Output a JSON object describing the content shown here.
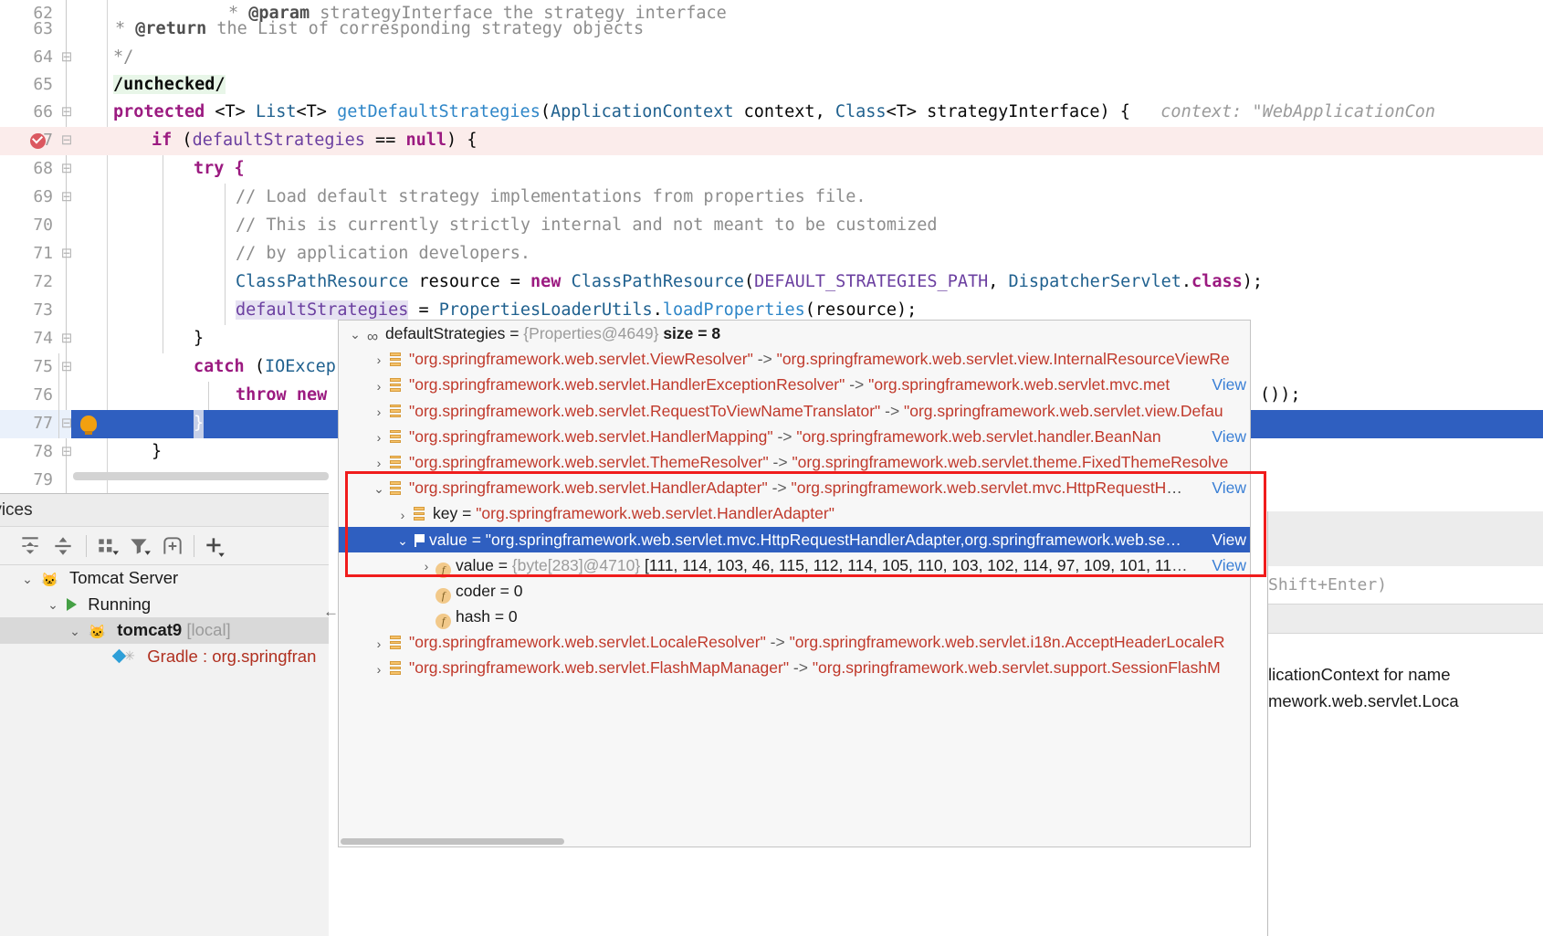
{
  "editor": {
    "lines": [
      {
        "num": "62",
        "fold": "",
        "kind": "jdoc"
      },
      {
        "num": "63",
        "fold": "",
        "kind": "jdoc2"
      },
      {
        "num": "64",
        "fold": "minus",
        "kind": "jdocend"
      },
      {
        "num": "65",
        "fold": "",
        "kind": "unchecked"
      },
      {
        "num": "66",
        "fold": "minus",
        "kind": "signature"
      },
      {
        "num": "67",
        "fold": "minus",
        "kind": "ifnull"
      },
      {
        "num": "68",
        "fold": "minus",
        "kind": "try"
      },
      {
        "num": "69",
        "fold": "minus",
        "kind": "c1"
      },
      {
        "num": "70",
        "fold": "",
        "kind": "c2"
      },
      {
        "num": "71",
        "fold": "minus",
        "kind": "c3"
      },
      {
        "num": "72",
        "fold": "",
        "kind": "cpr"
      },
      {
        "num": "73",
        "fold": "",
        "kind": "assign"
      },
      {
        "num": "74",
        "fold": "minus",
        "kind": "closeb"
      },
      {
        "num": "75",
        "fold": "minus",
        "kind": "catch"
      },
      {
        "num": "76",
        "fold": "",
        "kind": "throw"
      },
      {
        "num": "77",
        "fold": "minus",
        "kind": "sel"
      },
      {
        "num": "78",
        "fold": "minus",
        "kind": "closeb2"
      },
      {
        "num": "79",
        "fold": "",
        "kind": "blank"
      }
    ],
    "text": {
      "l62_star": "* ",
      "l62_tag": "@param",
      "l62_rest": " strategyInterface the strategy interface",
      "l63_star": "* ",
      "l63_tag": "@return",
      "l63_rest": " the List of corresponding strategy objects",
      "l64": "*/",
      "l65": "/unchecked/",
      "l66_kw": "protected",
      "l66_t1": " <T> ",
      "l66_t2": "List",
      "l66_t3": "<T> ",
      "l66_fn": "getDefaultStrategies",
      "l66_p1": "(",
      "l66_p2": "ApplicationContext",
      "l66_p3": " context, ",
      "l66_p4": "Class",
      "l66_p5": "<T> strategyInterface) {",
      "l66_hint": "context: \"WebApplicationCon",
      "l67_kw": "if",
      "l67_a": " (",
      "l67_var": "defaultStrategies",
      "l67_b": " == ",
      "l67_null": "null",
      "l67_c": ") {",
      "l68": "try {",
      "l69": "// Load default strategy implementations from properties file.",
      "l70": "// This is currently strictly internal and not meant to be customized",
      "l71": "// by application developers.",
      "l72_t": "ClassPathResource",
      "l72_a": " resource = ",
      "l72_new": "new",
      "l72_b": " ",
      "l72_t2": "ClassPathResource",
      "l72_c": "(",
      "l72_const": "DEFAULT_STRATEGIES_PATH",
      "l72_d": ", ",
      "l72_t3": "DispatcherServlet",
      "l72_e": ".",
      "l72_kw": "class",
      "l72_f": ");",
      "l73_var": "defaultStrategies",
      "l73_a": " = ",
      "l73_t": "PropertiesLoaderUtils",
      "l73_b": ".",
      "l73_fn": "loadProperties",
      "l73_c": "(resource);",
      "l74": "}",
      "l75_kw": "catch",
      "l75_a": " (",
      "l75_t": "IOExcep",
      "l76_kw": "throw new",
      "l76_tail": "());",
      "l77": "}",
      "l78": "}"
    }
  },
  "debugger": {
    "rows": [
      {
        "id": "root",
        "indent": 0,
        "twisty": "down",
        "icon": "oo",
        "name": "defaultStrategies",
        "eq": " = ",
        "type": "{Properties@4649}",
        "size": "size = 8",
        "view": "",
        "selected": false
      },
      {
        "id": "viewresolver",
        "indent": 1,
        "twisty": "right",
        "icon": "map",
        "key": "\"org.springframework.web.servlet.ViewResolver\"",
        "arrow": " -> ",
        "val": "\"org.springframework.web.servlet.view.InternalResourceViewRe",
        "view": "",
        "selected": false
      },
      {
        "id": "handlerexceptionresolver",
        "indent": 1,
        "twisty": "right",
        "icon": "map",
        "key": "\"org.springframework.web.servlet.HandlerExceptionResolver\"",
        "arrow": " -> ",
        "val": "\"org.springframework.web.servlet.mvc.met",
        "view": "View",
        "selected": false
      },
      {
        "id": "requesttoviewnametranslator",
        "indent": 1,
        "twisty": "right",
        "icon": "map",
        "key": "\"org.springframework.web.servlet.RequestToViewNameTranslator\"",
        "arrow": " -> ",
        "val": "\"org.springframework.web.servlet.view.Defau",
        "view": "",
        "selected": false
      },
      {
        "id": "handlermapping",
        "indent": 1,
        "twisty": "right",
        "icon": "map",
        "key": "\"org.springframework.web.servlet.HandlerMapping\"",
        "arrow": " -> ",
        "val": "\"org.springframework.web.servlet.handler.BeanNan",
        "view": "View",
        "selected": false
      },
      {
        "id": "themeresolver",
        "indent": 1,
        "twisty": "right",
        "icon": "map",
        "key": "\"org.springframework.web.servlet.ThemeResolver\"",
        "arrow": " -> ",
        "val": "\"org.springframework.web.servlet.theme.FixedThemeResolve",
        "view": "",
        "selected": false
      },
      {
        "id": "handleradapter",
        "indent": 1,
        "twisty": "down",
        "icon": "map",
        "key": "\"org.springframework.web.servlet.HandlerAdapter\"",
        "arrow": " -> ",
        "val": "\"org.springframework.web.servlet.mvc.HttpRequestH",
        "ellipsis": "…",
        "view": "View",
        "selected": false
      },
      {
        "id": "key",
        "indent": 2,
        "twisty": "right",
        "icon": "map",
        "name": "key",
        "eq": " = ",
        "val": "\"org.springframework.web.servlet.HandlerAdapter\"",
        "view": "",
        "selected": false
      },
      {
        "id": "value",
        "indent": 2,
        "twisty": "down",
        "icon": "flag",
        "name": "value",
        "eq": " = ",
        "val": "\"org.springframework.web.servlet.mvc.HttpRequestHandlerAdapter,org.springframework.web.se",
        "ellipsis": "…",
        "view": "View",
        "selected": true
      },
      {
        "id": "value-bytes",
        "indent": 3,
        "twisty": "right",
        "icon": "f",
        "name": "value",
        "eq": " = ",
        "type": "{byte[283]@4710}",
        "val": " [111, 114, 103, 46, 115, 112, 114, 105, 110, 103, 102, 114, 97, 109, 101, 11",
        "ellipsis": "…",
        "view": "View",
        "selected": false
      },
      {
        "id": "coder",
        "indent": 3,
        "twisty": "none",
        "icon": "f",
        "name": "coder",
        "eq": " = ",
        "val": "0",
        "view": "",
        "selected": false
      },
      {
        "id": "hash",
        "indent": 3,
        "twisty": "none",
        "icon": "f",
        "name": "hash",
        "eq": " = ",
        "val": "0",
        "view": "",
        "selected": false
      },
      {
        "id": "localeresolver",
        "indent": 1,
        "twisty": "right",
        "icon": "map",
        "key": "\"org.springframework.web.servlet.LocaleResolver\"",
        "arrow": " -> ",
        "val": "\"org.springframework.web.servlet.i18n.AcceptHeaderLocaleR",
        "view": "",
        "selected": false
      },
      {
        "id": "flashmapmanager",
        "indent": 1,
        "twisty": "right",
        "icon": "map",
        "key": "\"org.springframework.web.servlet.FlashMapManager\"",
        "arrow": " -> ",
        "val": "\"org.springframework.web.servlet.support.SessionFlashM",
        "view": "",
        "selected": false
      }
    ]
  },
  "services": {
    "tab_title": "rvices",
    "toolbar": [
      {
        "name": "expand-all-icon"
      },
      {
        "name": "collapse-all-icon"
      },
      {
        "name": "group-by-icon"
      },
      {
        "name": "filter-icon"
      },
      {
        "name": "add-tab-icon"
      },
      {
        "name": "add-icon"
      }
    ],
    "tree": [
      {
        "id": "tomcat-server",
        "indent": 0,
        "twisty": "down",
        "icon": "cat",
        "label": "Tomcat Server",
        "suffix": "",
        "bold": false,
        "selected": false
      },
      {
        "id": "running",
        "indent": 1,
        "twisty": "down",
        "icon": "play",
        "label": "Running",
        "suffix": "",
        "bold": false,
        "selected": false
      },
      {
        "id": "tomcat9",
        "indent": 2,
        "twisty": "down",
        "icon": "cat",
        "label": "tomcat9",
        "suffix": " [local]",
        "bold": true,
        "selected": true
      },
      {
        "id": "gradle",
        "indent": 3,
        "twisty": "none",
        "icon": "gradle",
        "label": "Gradle : org.springfran",
        "suffix": "",
        "bold": false,
        "selected": false
      }
    ]
  },
  "right_panel": {
    "hint": "Shift+Enter)",
    "line1": "licationContext for name",
    "line2": "mework.web.servlet.Loca"
  },
  "colors": {
    "selection_blue": "#2f5fc0",
    "breakpoint_red": "#db5860",
    "redbox": "#f01c1c",
    "string_red": "#c0392b",
    "keyword": "#9b1a80",
    "type_blue": "#20618f"
  }
}
